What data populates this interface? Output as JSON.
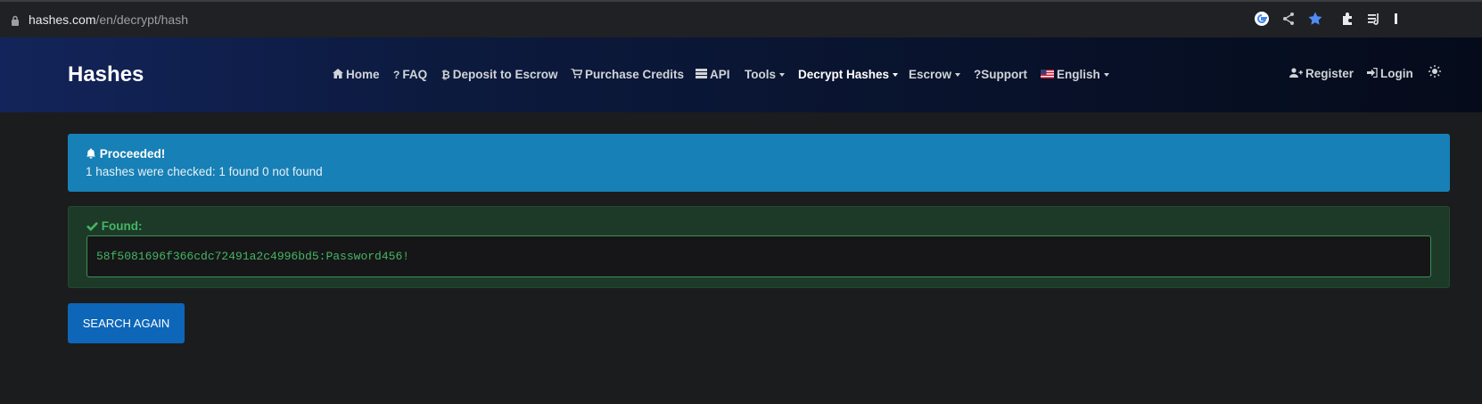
{
  "browser": {
    "url_host": "hashes.com",
    "url_path": "/en/decrypt/hash"
  },
  "navbar": {
    "brand": "Hashes",
    "items": [
      {
        "label": "Home",
        "icon": "home-icon"
      },
      {
        "label": "FAQ",
        "icon": "question-icon"
      },
      {
        "label": "Deposit to Escrow",
        "icon": "bitcoin-icon"
      },
      {
        "label": "Purchase Credits",
        "icon": "cart-icon"
      },
      {
        "label": "API",
        "icon": "server-icon"
      },
      {
        "label": "Tools"
      },
      {
        "label": "Decrypt Hashes"
      },
      {
        "label": "Escrow"
      },
      {
        "label": "?Support"
      },
      {
        "label": "English",
        "icon": "us-flag-icon"
      }
    ],
    "register": "Register",
    "login": "Login"
  },
  "info_alert": {
    "title": "Proceeded!",
    "message": "1 hashes were checked: 1 found 0 not found",
    "color": "#1780b6"
  },
  "found_alert": {
    "title": "Found:",
    "result": "58f5081696f366cdc72491a2c4996bd5:Password456!",
    "color": "#45b562"
  },
  "search_again_label": "SEARCH AGAIN"
}
